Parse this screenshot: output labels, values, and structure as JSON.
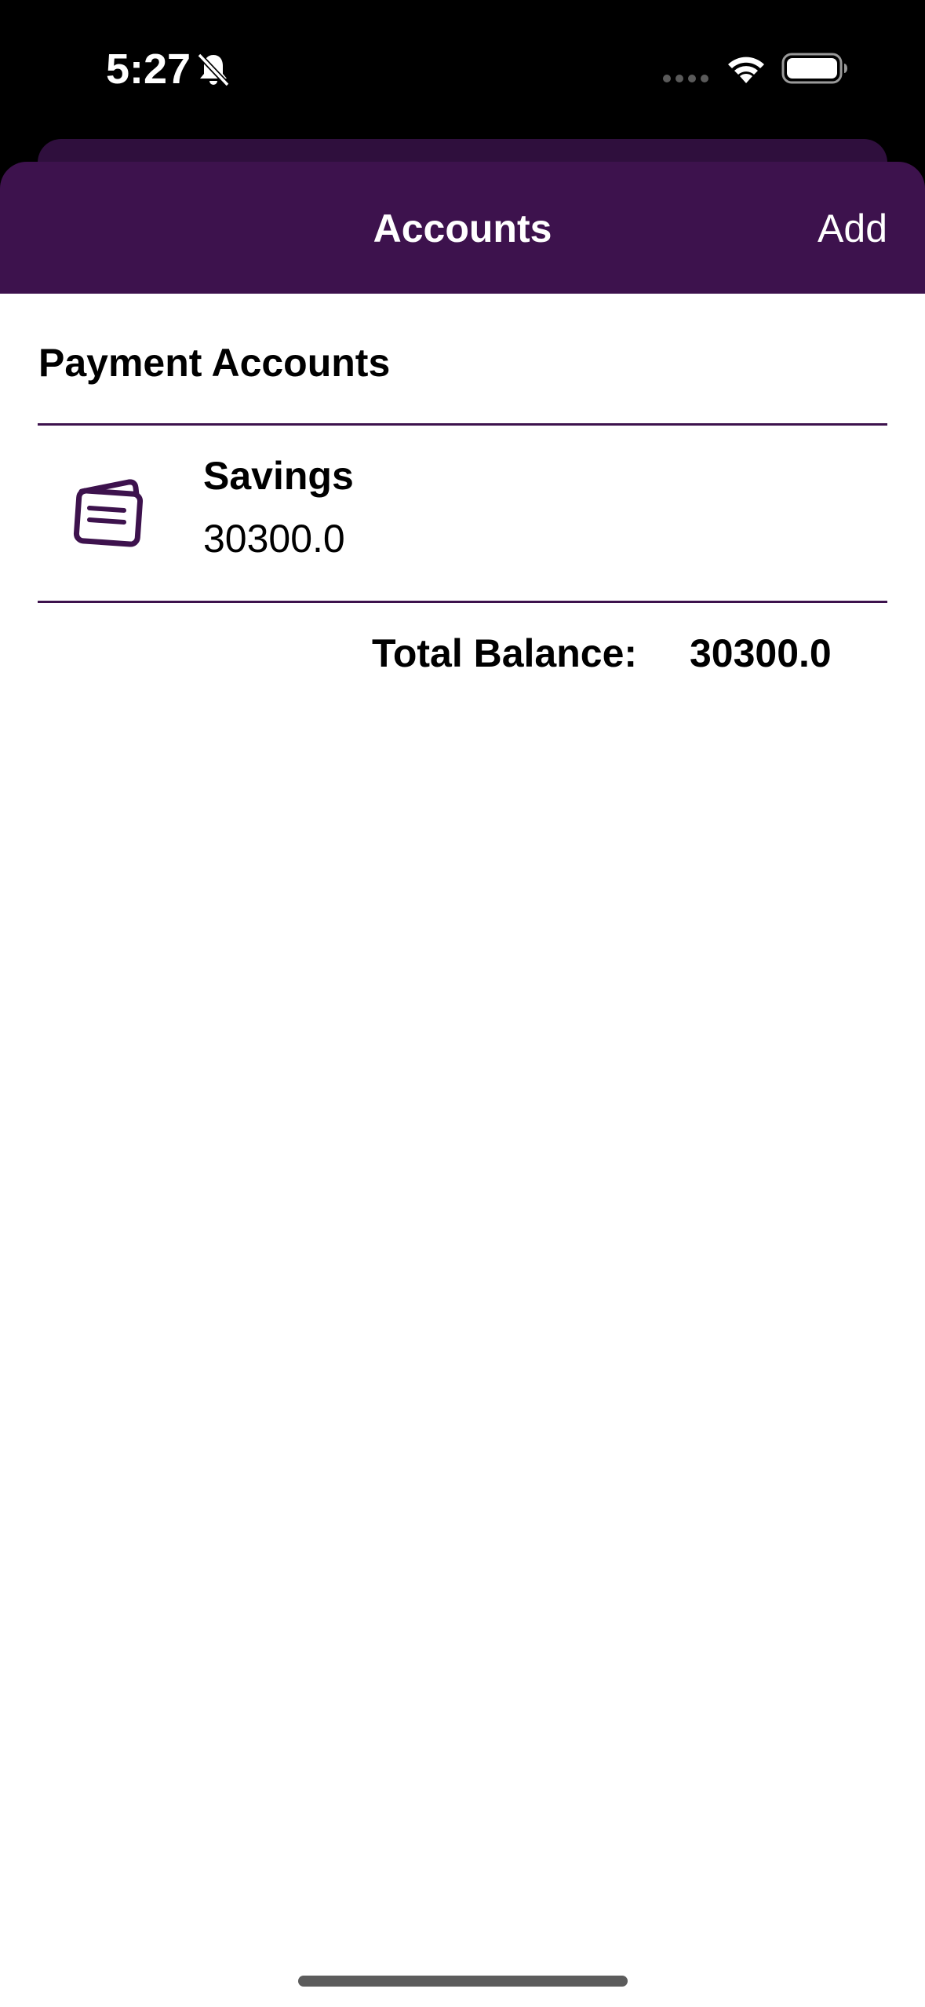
{
  "status_bar": {
    "time": "5:27",
    "icons": [
      "bell-slash-icon",
      "signal-icon",
      "wifi-icon",
      "battery-icon"
    ]
  },
  "nav": {
    "title": "Accounts",
    "add_label": "Add"
  },
  "section": {
    "title": "Payment Accounts"
  },
  "accounts": [
    {
      "name": "Savings",
      "balance": "30300.0",
      "icon": "wallet-icon"
    }
  ],
  "total": {
    "label": "Total Balance:",
    "value": "30300.0"
  },
  "colors": {
    "accent": "#3d124d",
    "background": "#ffffff",
    "status_bar": "#000000"
  }
}
